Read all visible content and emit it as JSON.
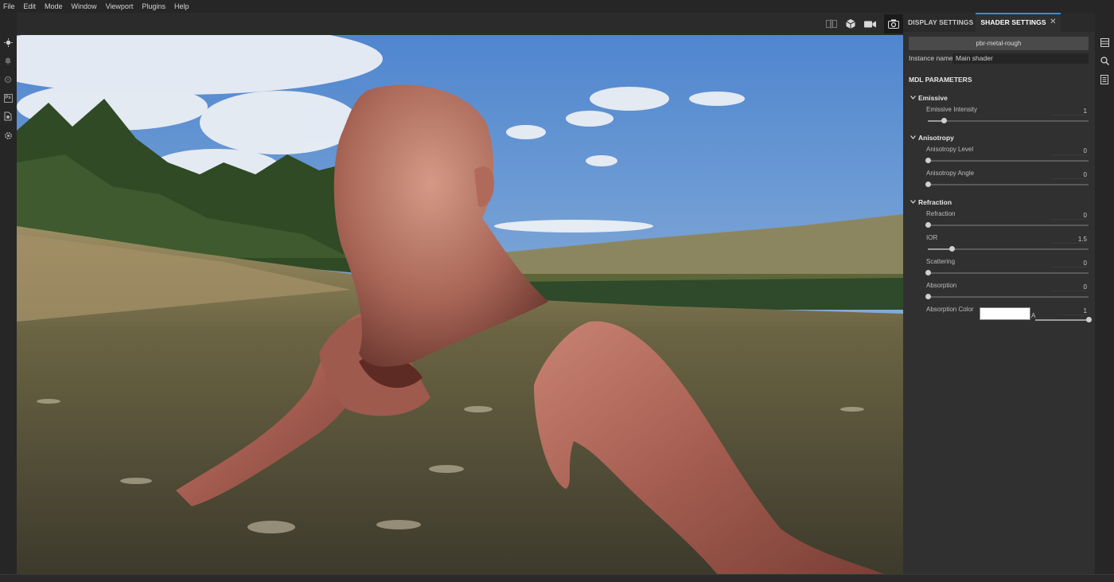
{
  "menu": [
    "File",
    "Edit",
    "Mode",
    "Window",
    "Viewport",
    "Plugins",
    "Help"
  ],
  "left_toolbar": {
    "icons": [
      "viewport-sun-icon",
      "bell-icon",
      "settings-dim-icon",
      "photoshop-icon",
      "document-gear-icon",
      "gear-icon"
    ],
    "ps_text": "Ps"
  },
  "viewport_toolbar": {
    "icons": [
      "split-view-icon",
      "cube-icon",
      "video-camera-icon",
      "screenshot-camera-icon"
    ]
  },
  "panel": {
    "tabs": [
      {
        "label": "DISPLAY SETTINGS",
        "active": false
      },
      {
        "label": "SHADER SETTINGS",
        "active": true
      }
    ],
    "close_glyph": "✕",
    "preset_button": "pbr-metal-rough",
    "instance_label": "Instance name",
    "instance_value": "Main shader",
    "section_title": "MDL PARAMETERS",
    "groups": [
      {
        "title": "Emissive",
        "params": [
          {
            "label": "Emissive Intensity",
            "value": "1",
            "slider_fraction": 0.1
          }
        ]
      },
      {
        "title": "Anisotropy",
        "params": [
          {
            "label": "Anisotropy Level",
            "value": "0",
            "slider_fraction": 0.0
          },
          {
            "label": "Anisotropy Angle",
            "value": "0",
            "slider_fraction": 0.0
          }
        ]
      },
      {
        "title": "Refraction",
        "params": [
          {
            "label": "Refraction",
            "value": "0",
            "slider_fraction": 0.0
          },
          {
            "label": "IOR",
            "value": "1.5",
            "slider_fraction": 0.15
          },
          {
            "label": "Scattering",
            "value": "0",
            "slider_fraction": 0.0
          },
          {
            "label": "Absorption",
            "value": "0",
            "slider_fraction": 0.0
          }
        ]
      }
    ],
    "absorption_color": {
      "label": "Absorption Color",
      "color": "#ffffff",
      "alpha_label": "A",
      "alpha_value": "1",
      "alpha_fraction": 1.0
    },
    "accent_color": "#2f8fe0"
  },
  "far_right_icons": [
    "layers-icon",
    "zoom-icon",
    "document-list-icon"
  ]
}
